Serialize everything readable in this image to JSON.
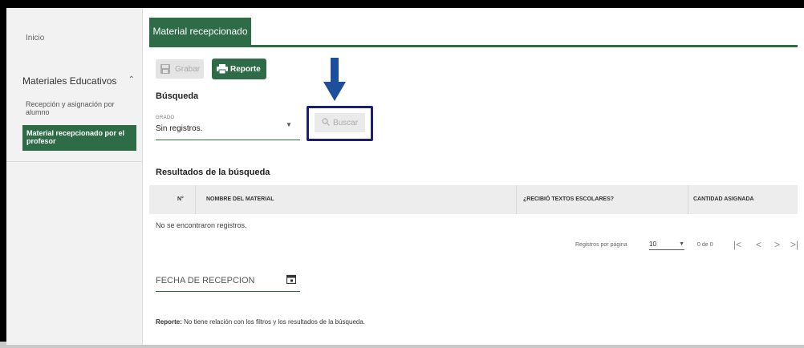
{
  "sidebar": {
    "inicio": "Inicio",
    "group_title": "Materiales Educativos",
    "items": [
      {
        "label": "Recepción y asignación por alumno"
      },
      {
        "label": "Material recepcionado por el profesor"
      }
    ]
  },
  "tab": {
    "label": "Material recepcionado"
  },
  "toolbar": {
    "grabar_label": "Grabar",
    "reporte_label": "Reporte"
  },
  "search": {
    "title": "Búsqueda",
    "grado_label": "GRADO",
    "grado_value": "Sin registros.",
    "buscar_label": "Buscar"
  },
  "results": {
    "title": "Resultados de la búsqueda",
    "columns": [
      "N°",
      "NOMBRE DEL MATERIAL",
      "¿RECIBIÓ TEXTOS ESCOLARES?",
      "CANTIDAD ASIGNADA"
    ],
    "empty_text": "No se encontraron registros."
  },
  "pagination": {
    "per_page_label": "Registros por página",
    "per_page_value": "10",
    "range_text": "0 de 0"
  },
  "fecha": {
    "placeholder": "FECHA DE RECEPCION"
  },
  "note": {
    "bold": "Reporte:",
    "text": " No tiene relación con los filtros y los resultados de la búsqueda."
  },
  "colors": {
    "primary": "#2e6c48",
    "highlight": "#1f1f6b",
    "arrow": "#1e4f9c"
  },
  "icons": [
    "save-icon",
    "print-icon",
    "search-icon",
    "calendar-icon",
    "down-arrow-icon",
    "chevron-up-icon"
  ]
}
